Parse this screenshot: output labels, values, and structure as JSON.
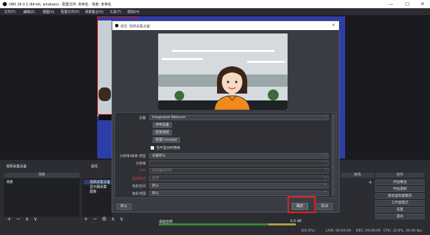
{
  "window": {
    "title": "OBS 26.0.2 (64-bit, windows) - 配置文件: 未命名 - 场景: 未命名",
    "min_glyph": "—",
    "max_glyph": "☐",
    "close_glyph": "✕"
  },
  "menubar": [
    "文件(F)",
    "编辑(E)",
    "视图(V)",
    "配置文件(P)",
    "场景集合(S)",
    "工具(T)",
    "帮助(H)"
  ],
  "dialog": {
    "title": "属性 '视频采集设备'",
    "close_glyph": "✕",
    "properties": {
      "device_label": "设备",
      "device_value": "Integrated Webcam",
      "deactivate_btn": "停用设备",
      "config_video_btn": "配置视频",
      "config_crossbar_btn": "配置Crossbar",
      "checkbox_label": "当不显示时停用",
      "res_type_label": "分辨率/帧率 类型",
      "res_type_value": "设备默认",
      "resolution_label": "分辨率",
      "fps_label": "FPS",
      "fps_value": "匹配输出FPS",
      "video_format_label": "视频格式",
      "video_format_value": "任何",
      "color_space_label": "色彩空间",
      "color_space_value": "默认",
      "color_range_label": "色彩范围",
      "color_range_value": "默认",
      "dropdown_arrow": "⌃"
    },
    "defaults_button": "默认",
    "ok_button": "确定",
    "cancel_button": "取消"
  },
  "docks": {
    "scenes": {
      "title": "视频采集设备",
      "header": "场景",
      "rows": [
        "场景"
      ],
      "toolbar": "+ − ∧ ∨"
    },
    "sources": {
      "header": "属性",
      "rows": [
        "视频采集设备",
        "显示器采集",
        "图像"
      ],
      "toolbar": "+ − ⚙ ∧ ∨"
    },
    "mixer": {
      "label": "桌面音频",
      "level": "0.0 dB"
    },
    "transitions": {
      "header": "转场",
      "plus_glyph": "+"
    },
    "controls": {
      "header": "控件",
      "buttons": [
        "开始推流",
        "开始录制",
        "启动虚拟摄像机",
        "工作室模式",
        "设置",
        "退出"
      ]
    }
  },
  "statusbar": {
    "dropped": "0(0.0%)",
    "live": "LIVE: 00:00:00",
    "rec": "REC: 00:00:00",
    "cpu": "CPU: 10.9%, 30.00 fps"
  }
}
